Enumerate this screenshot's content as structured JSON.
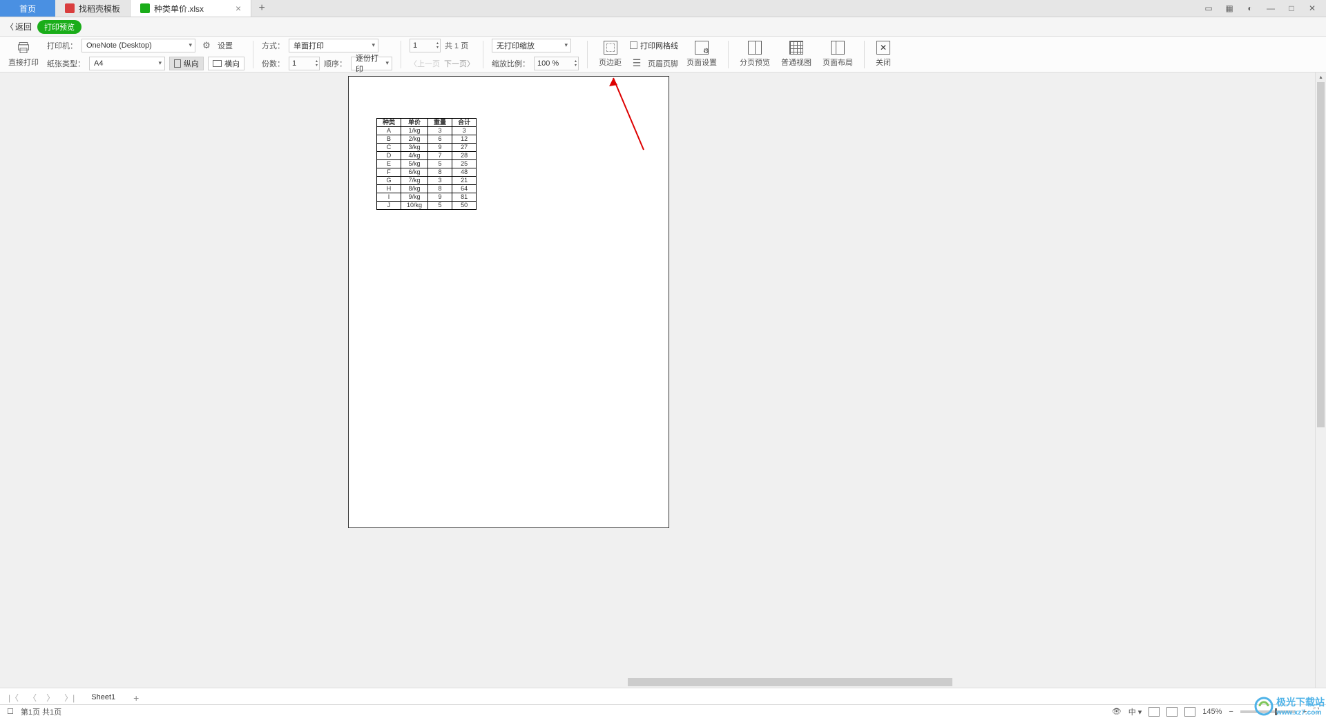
{
  "tabs": {
    "home": "首页",
    "templates": "找稻壳模板",
    "file": "种类单价.xlsx"
  },
  "returnbar": {
    "back": "返回",
    "badge": "打印预览"
  },
  "toolbar": {
    "direct_print": "直接打印",
    "printer_label": "打印机：",
    "printer_value": "OneNote (Desktop)",
    "settings": "设置",
    "paper_label": "纸张类型：",
    "paper_value": "A4",
    "portrait": "纵向",
    "landscape": "横向",
    "mode_label": "方式：",
    "mode_value": "单面打印",
    "copies_label": "份数：",
    "copies_value": "1",
    "order_label": "顺序：",
    "order_value": "逐份打印",
    "page_current": "1",
    "page_total": "共 1 页",
    "prev_page": "上一页",
    "next_page": "下一页",
    "scale_label": "缩放比例：",
    "scale_value": "100 %",
    "zoom_mode": "无打印缩放",
    "margins": "页边距",
    "print_gridlines": "打印网格线",
    "header_footer": "页眉页脚",
    "page_setup": "页面设置",
    "page_break": "分页预览",
    "normal_view": "普通视图",
    "page_layout": "页面布局",
    "close": "关闭"
  },
  "chart_data": {
    "type": "table",
    "headers": [
      "种类",
      "单价",
      "重量",
      "合计"
    ],
    "rows": [
      [
        "A",
        "1/kg",
        "3",
        "3"
      ],
      [
        "B",
        "2/kg",
        "6",
        "12"
      ],
      [
        "C",
        "3/kg",
        "9",
        "27"
      ],
      [
        "D",
        "4/kg",
        "7",
        "28"
      ],
      [
        "E",
        "5/kg",
        "5",
        "25"
      ],
      [
        "F",
        "6/kg",
        "8",
        "48"
      ],
      [
        "G",
        "7/kg",
        "3",
        "21"
      ],
      [
        "H",
        "8/kg",
        "8",
        "64"
      ],
      [
        "I",
        "9/kg",
        "9",
        "81"
      ],
      [
        "J",
        "10/kg",
        "5",
        "50"
      ]
    ]
  },
  "sheetbar": {
    "sheet1": "Sheet1"
  },
  "statusbar": {
    "page_info": "第1页 共1页",
    "zoom": "145%"
  },
  "watermark": {
    "brand": "极光下载站",
    "url": "www.xz7.com"
  }
}
